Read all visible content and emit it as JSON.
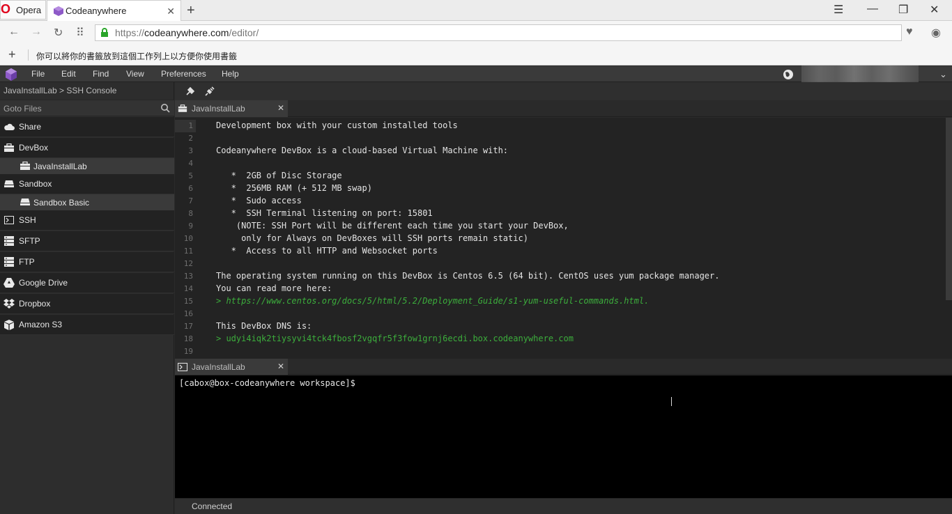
{
  "browser": {
    "menu_label": "Opera",
    "tab_title": "Codeanywhere",
    "url_scheme": "https://",
    "url_host": "codeanywhere.com",
    "url_path": "/editor/",
    "bookmarks_message": "你可以將你的書籤放到這個工作列上以方便你使用書籤"
  },
  "app": {
    "menu": [
      "File",
      "Edit",
      "Find",
      "View",
      "Preferences",
      "Help"
    ]
  },
  "sidebar": {
    "breadcrumb": "JavaInstallLab > SSH Console",
    "goto_placeholder": "Goto Files",
    "items": [
      {
        "label": "Share",
        "icon": "cloud-icon"
      },
      {
        "label": "DevBox",
        "icon": "briefcase-icon"
      },
      {
        "label": "JavaInstallLab",
        "icon": "briefcase-icon",
        "sub": true
      },
      {
        "label": "Sandbox",
        "icon": "sandbox-icon"
      },
      {
        "label": "Sandbox Basic",
        "icon": "sandbox-icon",
        "sub": true
      },
      {
        "label": "SSH",
        "icon": "terminal-icon"
      },
      {
        "label": "SFTP",
        "icon": "server-icon"
      },
      {
        "label": "FTP",
        "icon": "server-icon"
      },
      {
        "label": "Google Drive",
        "icon": "google-drive-icon"
      },
      {
        "label": "Dropbox",
        "icon": "dropbox-icon"
      },
      {
        "label": "Amazon S3",
        "icon": "amazon-s3-icon"
      }
    ]
  },
  "editor": {
    "tab_title": "JavaInstallLab",
    "lines": [
      "Development box with your custom installed tools",
      "",
      "Codeanywhere DevBox is a cloud-based Virtual Machine with:",
      "",
      "   *  2GB of Disc Storage",
      "   *  256MB RAM (+ 512 MB swap)",
      "   *  Sudo access",
      "   *  SSH Terminal listening on port: 15801",
      "    (NOTE: SSH Port will be different each time you start your DevBox,",
      "     only for Always on DevBoxes will SSH ports remain static)",
      "   *  Access to all HTTP and Websocket ports",
      "",
      "The operating system running on this DevBox is Centos 6.5 (64 bit). CentOS uses yum package manager.",
      "You can read more here:",
      "> https://www.centos.org/docs/5/html/5.2/Deployment_Guide/s1-yum-useful-commands.html.",
      "",
      "This DevBox DNS is:",
      "> udyi4iqk2tiysyvi4tck4fbosf2vgqfr5f3fow1grnj6ecdi.box.codeanywhere.com",
      ""
    ]
  },
  "terminal": {
    "tab_title": "JavaInstallLab",
    "prompt": "[cabox@box-codeanywhere workspace]$"
  },
  "status": {
    "text": "Connected"
  },
  "colors": {
    "accent_purple": "#8e5ac8",
    "link_green": "#3cae3c"
  }
}
